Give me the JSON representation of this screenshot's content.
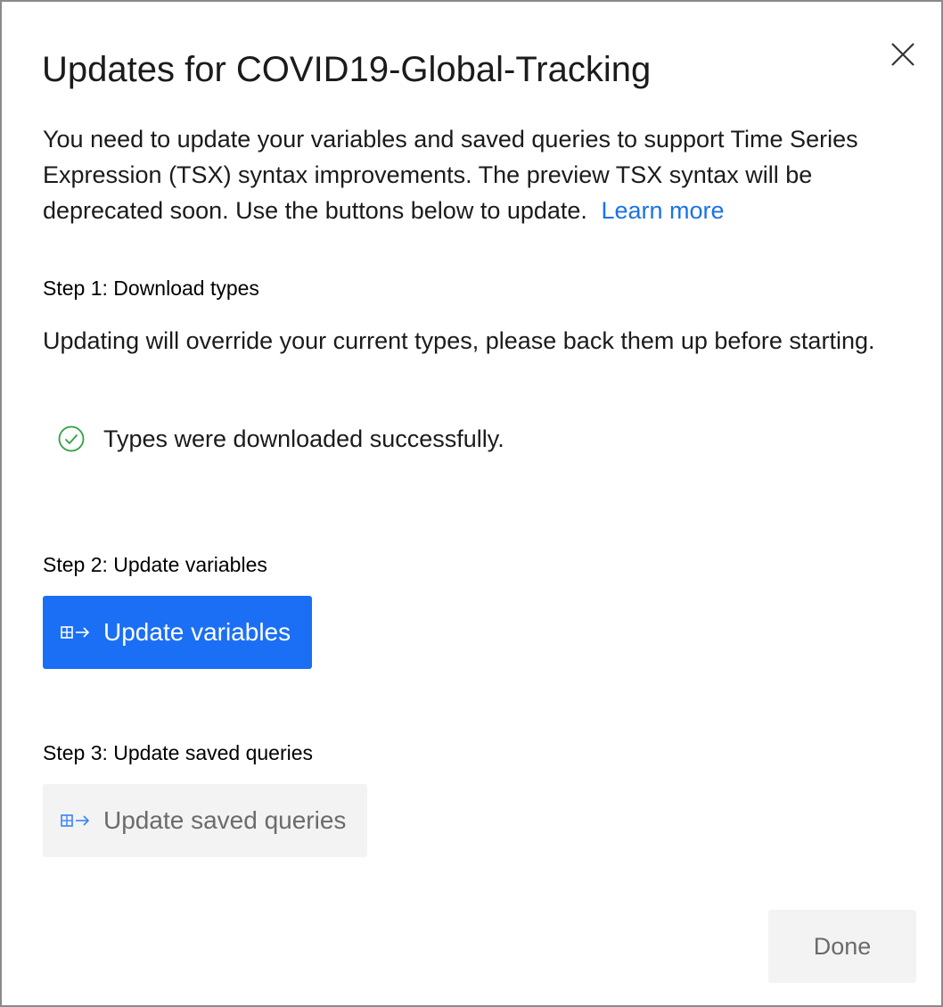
{
  "dialog": {
    "title": "Updates for COVID19-Global-Tracking",
    "intro_text": "You need to update your variables and saved queries to support Time Series Expression (TSX) syntax improvements. The preview TSX syntax will be deprecated soon. Use the buttons below to update.",
    "learn_more_label": "Learn more",
    "close_icon": "close-icon"
  },
  "step1": {
    "title": "Step 1: Download types",
    "description": "Updating will override your current types, please back them up before starting.",
    "status_text": "Types were downloaded successfully.",
    "status_icon": "check-circle-icon",
    "status_color": "#2ea043"
  },
  "step2": {
    "title": "Step 2: Update variables",
    "button_label": "Update variables",
    "button_icon": "table-arrow-icon",
    "button_color": "#1a6ff5"
  },
  "step3": {
    "title": "Step 3: Update saved queries",
    "button_label": "Update saved queries",
    "button_icon": "table-arrow-icon",
    "button_state": "disabled"
  },
  "footer": {
    "done_label": "Done",
    "done_state": "disabled"
  },
  "colors": {
    "accent": "#1a6ff5",
    "link": "#1a73e8",
    "success": "#2ea043"
  }
}
